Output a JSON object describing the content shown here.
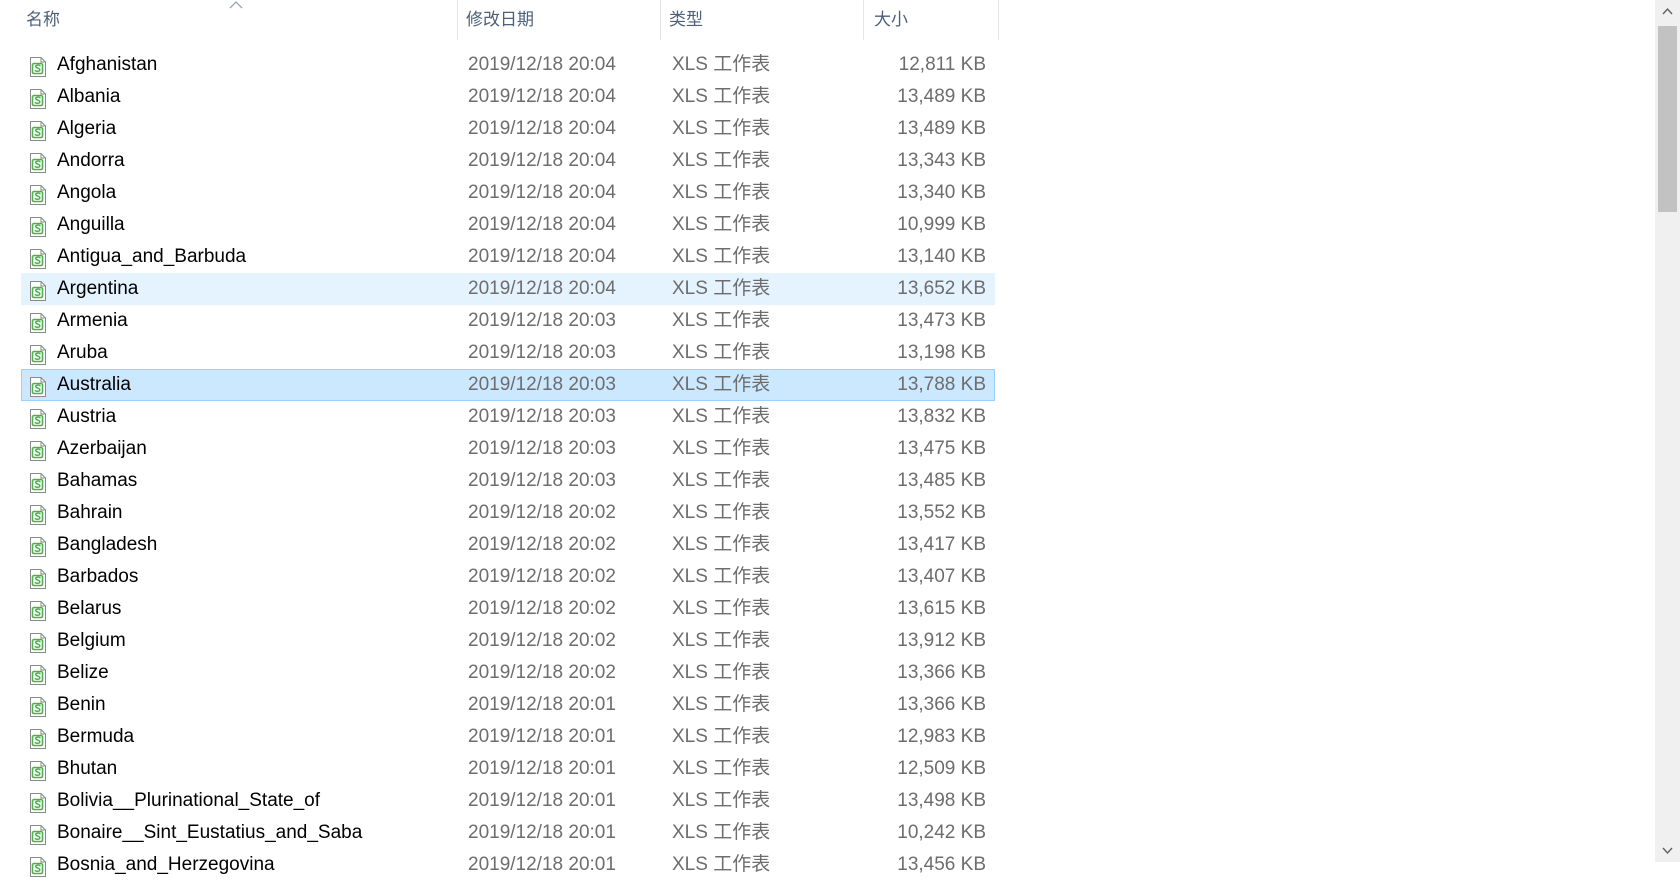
{
  "header": {
    "name": "名称",
    "date": "修改日期",
    "type": "类型",
    "size": "大小"
  },
  "files": [
    {
      "name": "Afghanistan",
      "date": "2019/12/18 20:04",
      "type": "XLS 工作表",
      "size": "12,811 KB"
    },
    {
      "name": "Albania",
      "date": "2019/12/18 20:04",
      "type": "XLS 工作表",
      "size": "13,489 KB"
    },
    {
      "name": "Algeria",
      "date": "2019/12/18 20:04",
      "type": "XLS 工作表",
      "size": "13,489 KB"
    },
    {
      "name": "Andorra",
      "date": "2019/12/18 20:04",
      "type": "XLS 工作表",
      "size": "13,343 KB"
    },
    {
      "name": "Angola",
      "date": "2019/12/18 20:04",
      "type": "XLS 工作表",
      "size": "13,340 KB"
    },
    {
      "name": "Anguilla",
      "date": "2019/12/18 20:04",
      "type": "XLS 工作表",
      "size": "10,999 KB"
    },
    {
      "name": "Antigua_and_Barbuda",
      "date": "2019/12/18 20:04",
      "type": "XLS 工作表",
      "size": "13,140 KB"
    },
    {
      "name": "Argentina",
      "date": "2019/12/18 20:04",
      "type": "XLS 工作表",
      "size": "13,652 KB",
      "state": "hover"
    },
    {
      "name": "Armenia",
      "date": "2019/12/18 20:03",
      "type": "XLS 工作表",
      "size": "13,473 KB"
    },
    {
      "name": "Aruba",
      "date": "2019/12/18 20:03",
      "type": "XLS 工作表",
      "size": "13,198 KB"
    },
    {
      "name": "Australia",
      "date": "2019/12/18 20:03",
      "type": "XLS 工作表",
      "size": "13,788 KB",
      "state": "selected"
    },
    {
      "name": "Austria",
      "date": "2019/12/18 20:03",
      "type": "XLS 工作表",
      "size": "13,832 KB"
    },
    {
      "name": "Azerbaijan",
      "date": "2019/12/18 20:03",
      "type": "XLS 工作表",
      "size": "13,475 KB"
    },
    {
      "name": "Bahamas",
      "date": "2019/12/18 20:03",
      "type": "XLS 工作表",
      "size": "13,485 KB"
    },
    {
      "name": "Bahrain",
      "date": "2019/12/18 20:02",
      "type": "XLS 工作表",
      "size": "13,552 KB"
    },
    {
      "name": "Bangladesh",
      "date": "2019/12/18 20:02",
      "type": "XLS 工作表",
      "size": "13,417 KB"
    },
    {
      "name": "Barbados",
      "date": "2019/12/18 20:02",
      "type": "XLS 工作表",
      "size": "13,407 KB"
    },
    {
      "name": "Belarus",
      "date": "2019/12/18 20:02",
      "type": "XLS 工作表",
      "size": "13,615 KB"
    },
    {
      "name": "Belgium",
      "date": "2019/12/18 20:02",
      "type": "XLS 工作表",
      "size": "13,912 KB"
    },
    {
      "name": "Belize",
      "date": "2019/12/18 20:02",
      "type": "XLS 工作表",
      "size": "13,366 KB"
    },
    {
      "name": "Benin",
      "date": "2019/12/18 20:01",
      "type": "XLS 工作表",
      "size": "13,366 KB"
    },
    {
      "name": "Bermuda",
      "date": "2019/12/18 20:01",
      "type": "XLS 工作表",
      "size": "12,983 KB"
    },
    {
      "name": "Bhutan",
      "date": "2019/12/18 20:01",
      "type": "XLS 工作表",
      "size": "12,509 KB"
    },
    {
      "name": "Bolivia__Plurinational_State_of",
      "date": "2019/12/18 20:01",
      "type": "XLS 工作表",
      "size": "13,498 KB"
    },
    {
      "name": "Bonaire__Sint_Eustatius_and_Saba",
      "date": "2019/12/18 20:01",
      "type": "XLS 工作表",
      "size": "10,242 KB"
    },
    {
      "name": "Bosnia_and_Herzegovina",
      "date": "2019/12/18 20:01",
      "type": "XLS 工作表",
      "size": "13,456 KB"
    }
  ],
  "icons": {
    "sort": "sort-ascending-icon",
    "file": "spreadsheet-file-icon",
    "scroll_up": "chevron-up-icon",
    "scroll_down": "chevron-down-icon"
  },
  "colors": {
    "header_text": "#4c607a",
    "hover_bg": "#e5f3ff",
    "selected_bg": "#cce8ff",
    "selected_border": "#99d1ff",
    "icon_green": "#4caf50"
  }
}
